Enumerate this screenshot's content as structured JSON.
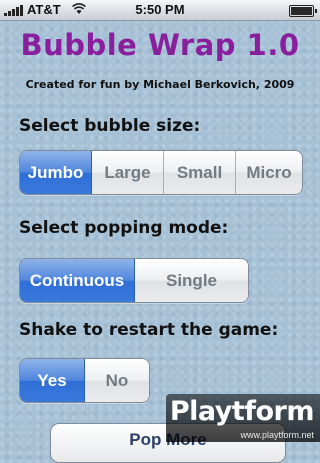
{
  "status_bar": {
    "carrier": "AT&T",
    "time": "5:50 PM"
  },
  "app": {
    "title": "Bubble Wrap 1.0",
    "credit": "Created for fun by Michael Berkovich, 2009"
  },
  "bubble_size": {
    "label": "Select bubble size:",
    "options": [
      "Jumbo",
      "Large",
      "Small",
      "Micro"
    ],
    "selected": "Jumbo"
  },
  "popping_mode": {
    "label": "Select popping mode:",
    "options": [
      "Continuous",
      "Single"
    ],
    "selected": "Continuous"
  },
  "shake": {
    "label": "Shake to restart the game:",
    "options": [
      "Yes",
      "No"
    ],
    "selected": "Yes"
  },
  "pop_more_button": "Pop More",
  "watermark": {
    "logo": "Playtform",
    "url": "www.playtform.net"
  },
  "colors": {
    "title": "#8a1f9e",
    "selected_segment": "#3a78db",
    "background": "#a6c1d6"
  }
}
